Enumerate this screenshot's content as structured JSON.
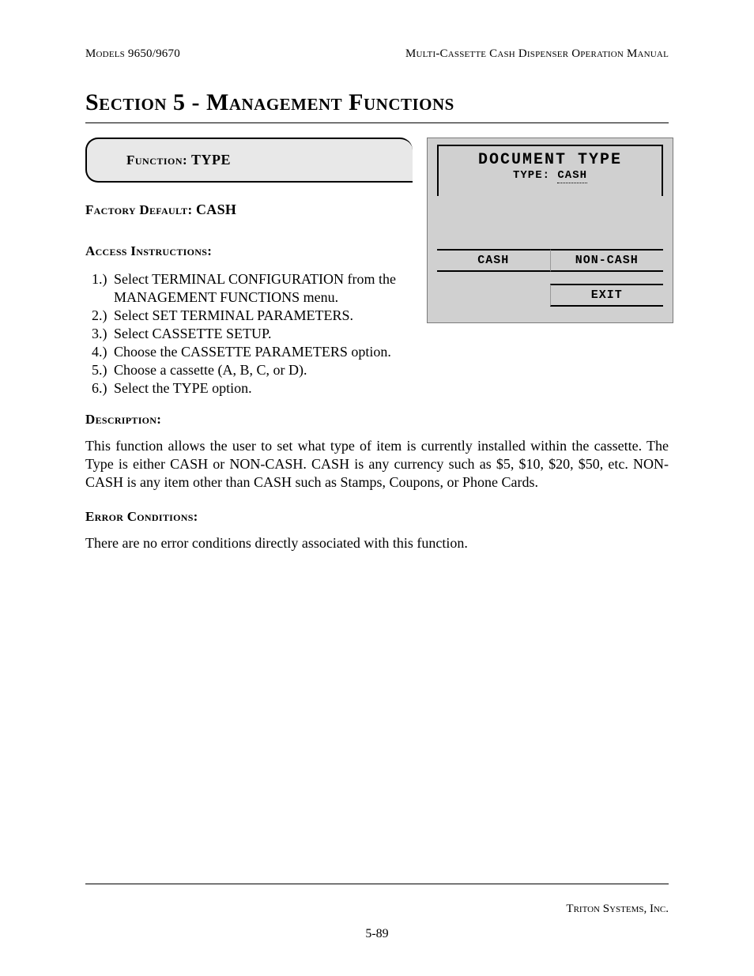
{
  "header": {
    "left": "Models 9650/9670",
    "right": "Multi-Cassette Cash Dispenser Operation Manual"
  },
  "section_title": "Section 5 - Management Functions",
  "function_box": {
    "label": "Function:",
    "value": "TYPE"
  },
  "factory_default": {
    "label": "Factory Default:",
    "value": "CASH"
  },
  "access_heading": "Access Instructions:",
  "access_steps": [
    {
      "num": "1.)",
      "text": "Select TERMINAL CONFIGURATION from the MANAGEMENT FUNCTIONS menu."
    },
    {
      "num": "2.)",
      "text": "Select SET TERMINAL PARAMETERS."
    },
    {
      "num": "3.)",
      "text": "Select CASSETTE SETUP."
    },
    {
      "num": "4.)",
      "text": "Choose the CASSETTE PARAMETERS option."
    },
    {
      "num": "5.)",
      "text": "Choose a cassette (A, B, C, or D)."
    },
    {
      "num": "6.)",
      "text": "Select the TYPE option."
    }
  ],
  "description_heading": "Description:",
  "description_body": "This function allows the user to set what type of item is currently installed within the cassette.  The Type is either CASH or NON-CASH.  CASH is any currency such as $5, $10, $20, $50, etc.  NON-CASH is any item other than CASH such as Stamps, Coupons, or Phone Cards.",
  "error_heading": "Error Conditions:",
  "error_body": "There are no error conditions directly associated with this function.",
  "screen": {
    "title": "DOCUMENT TYPE",
    "sub_label": "TYPE:",
    "sub_value": "CASH",
    "btn_cash": "CASH",
    "btn_noncash": "NON-CASH",
    "btn_exit": "EXIT"
  },
  "footer": {
    "company": "Triton Systems, Inc.",
    "page": "5-89"
  }
}
